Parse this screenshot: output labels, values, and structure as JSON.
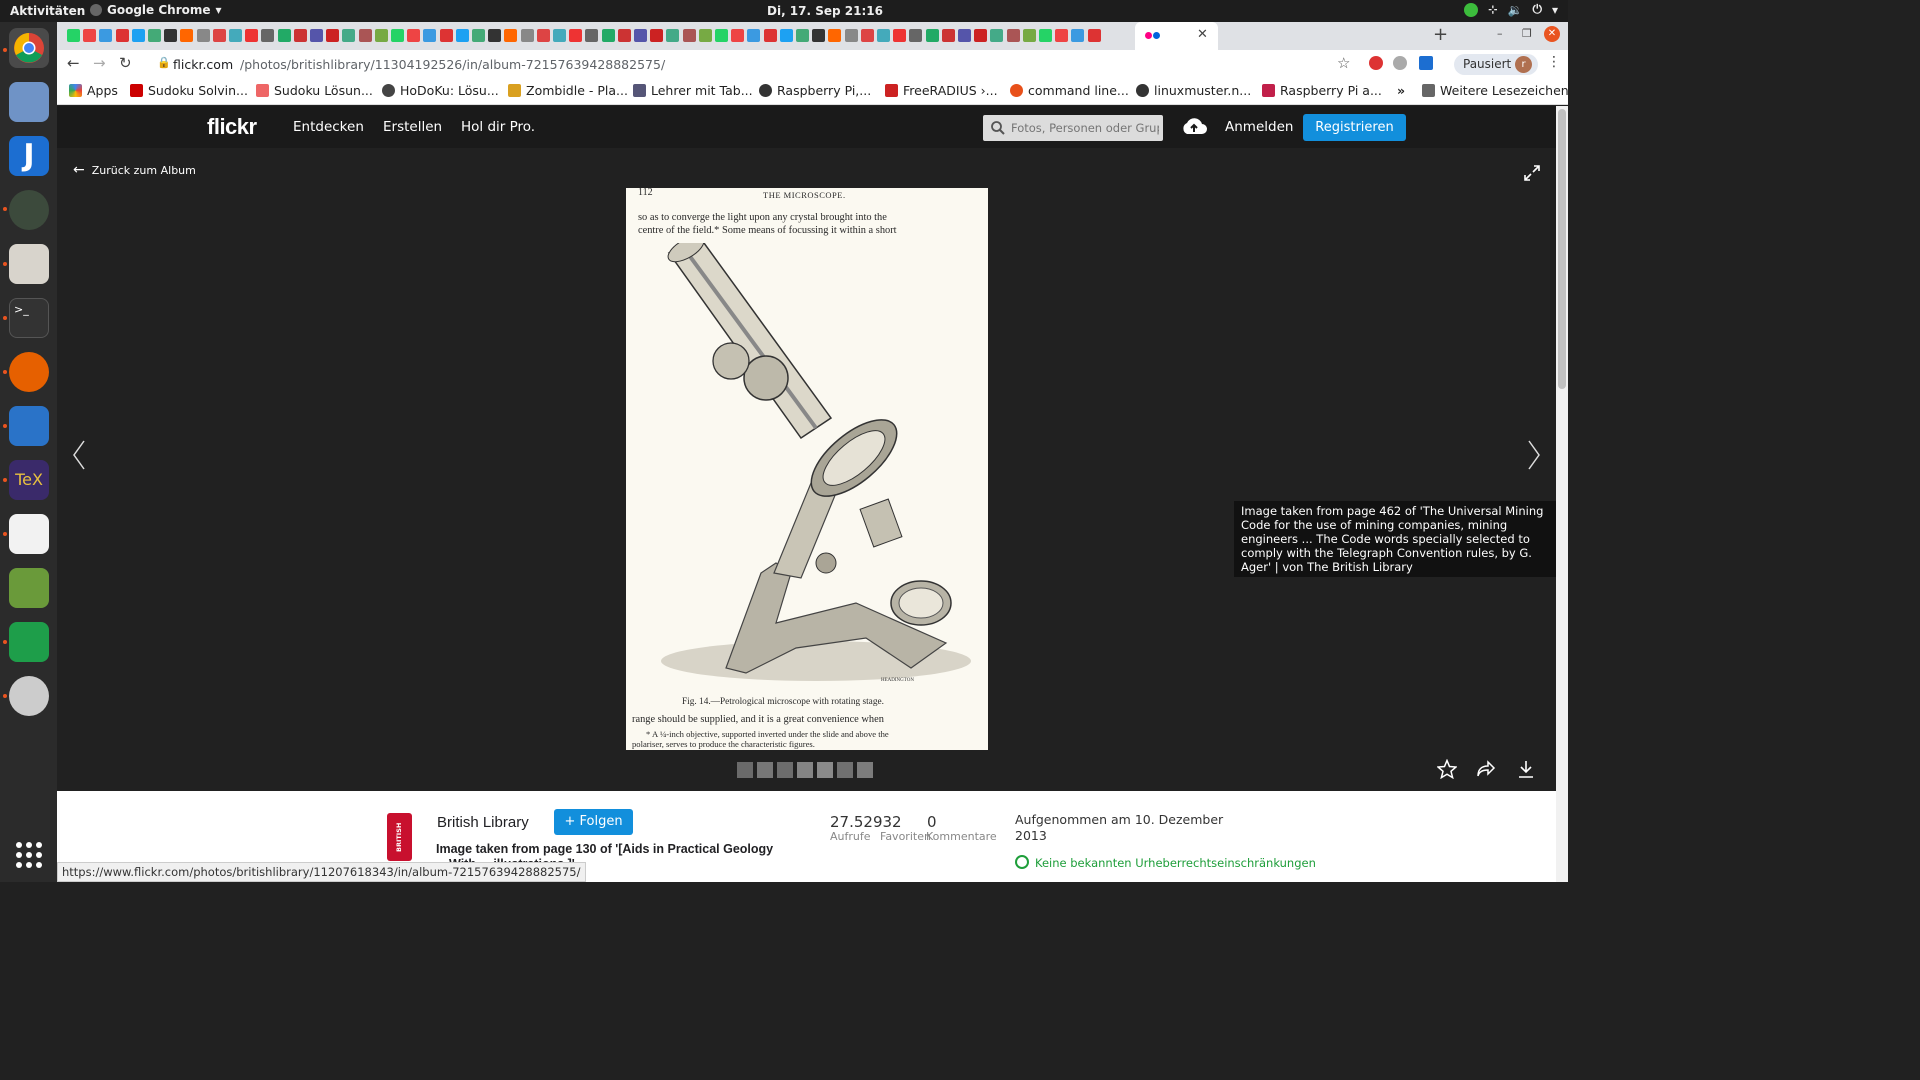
{
  "system": {
    "activities": "Aktivitäten",
    "app_name": "Google Chrome",
    "clock": "Di, 17. Sep  21:16"
  },
  "browser": {
    "url_domain": "flickr.com",
    "url_path": "/photos/britishlibrary/11304192526/in/album-72157639428882575/",
    "profile_label": "Pausiert",
    "profile_initial": "r",
    "status_url": "https://www.flickr.com/photos/britishlibrary/11207618343/in/album-72157639428882575/"
  },
  "bookmarks": {
    "items": [
      "Apps",
      "Sudoku Solvin...",
      "Sudoku Lösun...",
      "HoDoKu: Lösu...",
      "Zombidle - Pla...",
      "Lehrer mit Tab...",
      "Raspberry Pi,...",
      "FreeRADIUS ›...",
      "command line...",
      "linuxmuster.n...",
      "Raspberry Pi a..."
    ],
    "more": "»",
    "other": "Weitere Lesezeichen"
  },
  "flickr": {
    "logo": "flickr",
    "nav": [
      "Entdecken",
      "Erstellen",
      "Hol dir Pro."
    ],
    "search_placeholder": "Fotos, Personen oder Gruppen",
    "login": "Anmelden",
    "register": "Registrieren",
    "back_label": "Zurück zum Album"
  },
  "photo": {
    "page_number": "112",
    "running_head": "THE MICROSCOPE.",
    "line1": "so as to converge the light upon any crystal brought into the",
    "line2": "centre of the field.*   Some means of focussing it within a short",
    "caption": "Fig. 14.—Petrological microscope with rotating stage.",
    "line3": "range should be supplied, and it is a great convenience when",
    "footnote1": "* A ¼-inch objective, supported inverted under the slide and above the",
    "footnote2": "polariser, serves to produce the characteristic figures.",
    "engraver": "HEADINGTON"
  },
  "tooltip": "Image taken from page 462 of 'The Universal Mining Code for the use of mining companies, mining engineers ... The Code words specially selected to comply with the Telegraph Convention rules, by G. Ager' | von The British Library",
  "info": {
    "owner": "British Library",
    "badge_text": "BRITISH LIBRARY",
    "follow": "Folgen",
    "title": "Image taken from page 130 of '[Aids in Practical Geology",
    "title2": "With ... illustrations.]'",
    "views_value": "27.52932",
    "views_label": "Aufrufe",
    "faves_value": "0",
    "faves_label": "Favoriten",
    "comments_label": "Kommentare",
    "taken": "Aufgenommen am 10. Dezember 2013",
    "license": "Keine bekannten Urheberrechtseinschränkungen"
  },
  "colors": {
    "flickr_blue": "#128fdc",
    "dark_bg": "#212121",
    "license_green": "#1e9e3a"
  }
}
